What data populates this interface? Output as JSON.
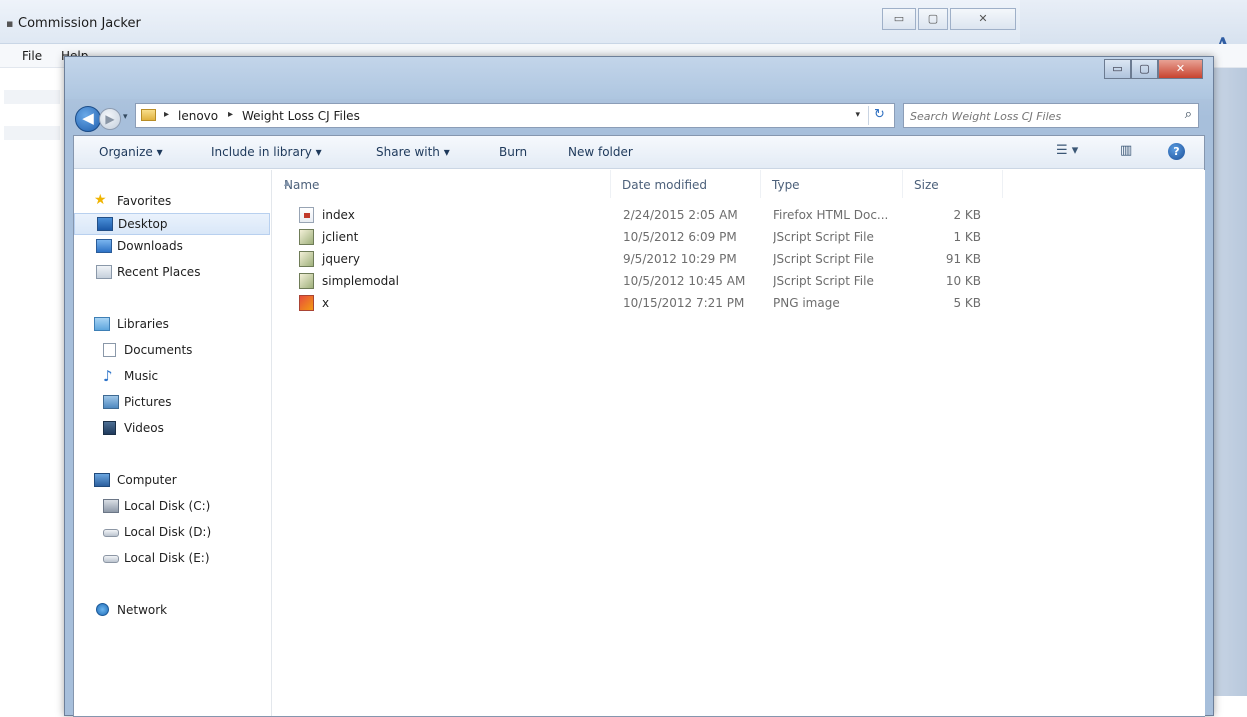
{
  "background_window": {
    "title": "Commission Jacker",
    "app_icon": "app-icon",
    "menu": [
      "File",
      "Help"
    ],
    "controls": {
      "minimize": "▭",
      "maximize": "▢",
      "close": "✕"
    }
  },
  "explorer": {
    "caption": {
      "minimize": "▭",
      "maximize": "▢",
      "close": "✕"
    },
    "nav": {
      "back": "◀",
      "forward": "▶",
      "history_dropdown": "▾"
    },
    "address": {
      "crumbs": [
        "lenovo",
        "Weight Loss CJ Files"
      ],
      "separator": "▸",
      "dropdown": "▾",
      "refresh": "↻"
    },
    "search": {
      "placeholder": "Search Weight Loss CJ Files",
      "icon": "search-icon",
      "glyph": "⌕"
    },
    "toolbar": {
      "organize": "Organize ▾",
      "include_in_library": "Include in library ▾",
      "share_with": "Share with ▾",
      "burn": "Burn",
      "new_folder": "New folder",
      "view_options": "☰ ▾",
      "preview_pane": "▥",
      "help": "?"
    },
    "nav_pane": {
      "favorites": {
        "label": "Favorites",
        "icon": "star-icon",
        "glyph": "★"
      },
      "favorites_items": [
        {
          "label": "Desktop",
          "icon": "desktop-icon",
          "selected": true
        },
        {
          "label": "Downloads",
          "icon": "downloads-icon",
          "selected": false
        },
        {
          "label": "Recent Places",
          "icon": "recent-places-icon",
          "selected": false
        }
      ],
      "libraries": {
        "label": "Libraries",
        "icon": "libraries-icon"
      },
      "libraries_items": [
        {
          "label": "Documents",
          "icon": "documents-icon"
        },
        {
          "label": "Music",
          "icon": "music-icon",
          "glyph": "♪"
        },
        {
          "label": "Pictures",
          "icon": "pictures-icon"
        },
        {
          "label": "Videos",
          "icon": "videos-icon"
        }
      ],
      "computer": {
        "label": "Computer",
        "icon": "computer-icon"
      },
      "computer_items": [
        {
          "label": "Local Disk (C:)",
          "icon": "system-disk-icon"
        },
        {
          "label": "Local Disk (D:)",
          "icon": "disk-icon"
        },
        {
          "label": "Local Disk (E:)",
          "icon": "disk-icon"
        }
      ],
      "network": {
        "label": "Network",
        "icon": "network-icon"
      }
    },
    "columns": [
      "Name",
      "Date modified",
      "Type",
      "Size"
    ],
    "sort_indicator": "▲",
    "files": [
      {
        "name": "index",
        "date": "2/24/2015 2:05 AM",
        "type": "Firefox HTML Doc...",
        "size": "2 KB",
        "icon": "html-file-icon"
      },
      {
        "name": "jclient",
        "date": "10/5/2012 6:09 PM",
        "type": "JScript Script File",
        "size": "1 KB",
        "icon": "jscript-file-icon"
      },
      {
        "name": "jquery",
        "date": "9/5/2012 10:29 PM",
        "type": "JScript Script File",
        "size": "91 KB",
        "icon": "jscript-file-icon"
      },
      {
        "name": "simplemodal",
        "date": "10/5/2012 10:45 AM",
        "type": "JScript Script File",
        "size": "10 KB",
        "icon": "jscript-file-icon"
      },
      {
        "name": "x",
        "date": "10/15/2012 7:21 PM",
        "type": "PNG image",
        "size": "5 KB",
        "icon": "png-file-icon"
      }
    ],
    "colors": {
      "accent": "#2e6fc0",
      "frame": "#a7bfdb",
      "selection": "#d9e7f8",
      "muted_text": "#6d6d6d"
    }
  }
}
